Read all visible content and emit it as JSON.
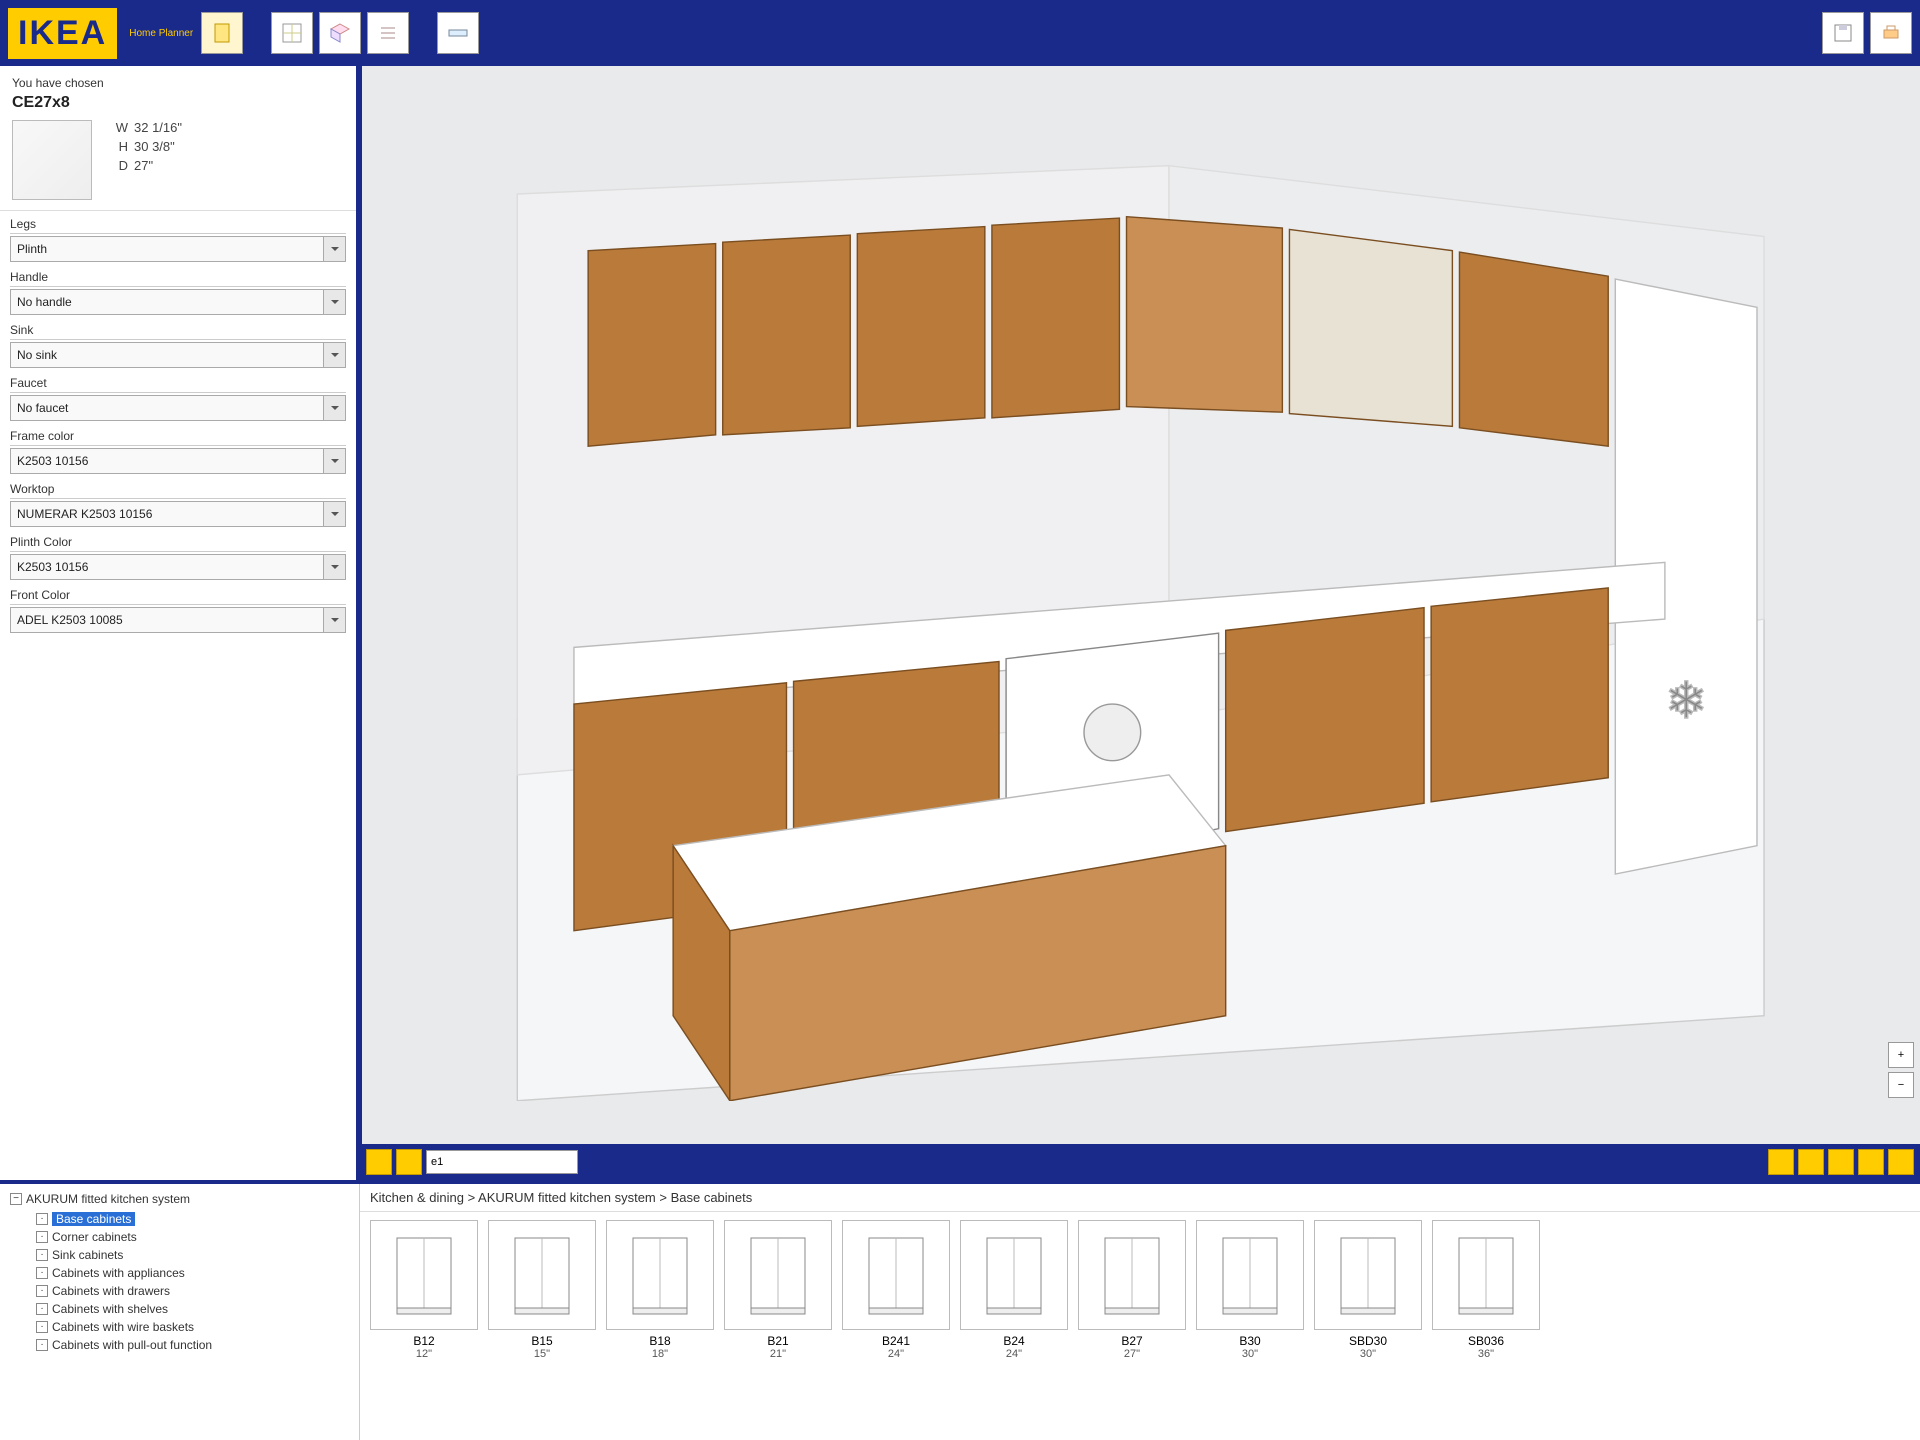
{
  "header": {
    "brand": "IKEA",
    "subtitle": "Home Planner"
  },
  "chosen": {
    "title": "You have chosen",
    "code": "CE27x8",
    "dims": {
      "w_label": "W",
      "w": "32 1/16\"",
      "h_label": "H",
      "h": "30 3/8\"",
      "d_label": "D",
      "d": "27\""
    }
  },
  "properties": [
    {
      "label": "Legs",
      "value": "Plinth"
    },
    {
      "label": "Handle",
      "value": "No handle"
    },
    {
      "label": "Sink",
      "value": "No sink"
    },
    {
      "label": "Faucet",
      "value": "No faucet"
    },
    {
      "label": "Frame color",
      "value": "K2503 10156"
    },
    {
      "label": "Worktop",
      "value": "NUMERAR K2503 10156"
    },
    {
      "label": "Plinth Color",
      "value": "K2503 10156"
    },
    {
      "label": "Front Color",
      "value": "ADEL K2503 10085"
    }
  ],
  "view_toolbar": {
    "level": "e1"
  },
  "tree": {
    "root": "AKURUM fitted kitchen system",
    "selected": "Base cabinets",
    "children": [
      "Base cabinets",
      "Corner cabinets",
      "Sink cabinets",
      "Cabinets with appliances",
      "Cabinets with drawers",
      "Cabinets with shelves",
      "Cabinets with wire baskets",
      "Cabinets with pull-out function"
    ]
  },
  "breadcrumb": "Kitchen & dining > AKURUM fitted kitchen system > Base cabinets",
  "catalog": [
    {
      "name": "B12",
      "dim": "12\""
    },
    {
      "name": "B15",
      "dim": "15\""
    },
    {
      "name": "B18",
      "dim": "18\""
    },
    {
      "name": "B21",
      "dim": "21\""
    },
    {
      "name": "B241",
      "dim": "24\""
    },
    {
      "name": "B24",
      "dim": "24\""
    },
    {
      "name": "B27",
      "dim": "27\""
    },
    {
      "name": "B30",
      "dim": "30\""
    },
    {
      "name": "SBD30",
      "dim": "30\""
    },
    {
      "name": "SB036",
      "dim": "36\""
    }
  ]
}
